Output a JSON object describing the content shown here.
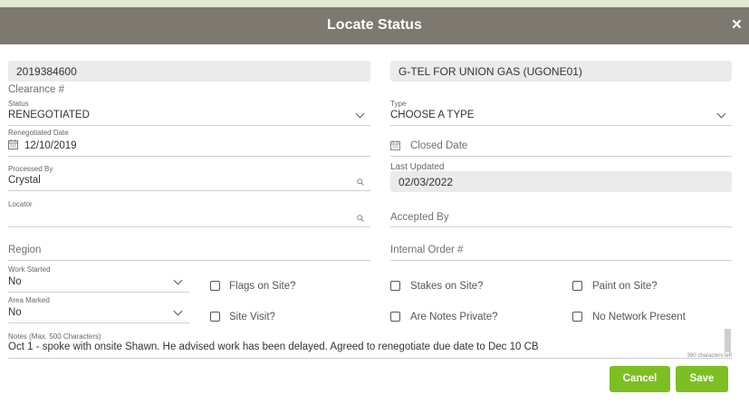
{
  "dialog": {
    "title": "Locate Status",
    "close_symbol": "×"
  },
  "fields": {
    "ticket_number": "2019384600",
    "company": "G-TEL FOR UNION GAS (UGONE01)",
    "clearance_placeholder": "Clearance #",
    "status_label": "Status",
    "status_value": "RENEGOTIATED",
    "type_label": "Type",
    "type_value": "CHOOSE A TYPE",
    "renegotiated_date_label": "Renegotiated Date",
    "renegotiated_date_value": "12/10/2019",
    "closed_date_placeholder": "Closed Date",
    "processed_by_label": "Processed By",
    "processed_by_value": "Crystal",
    "last_updated_label": "Last Updated",
    "last_updated_value": "02/03/2022",
    "locator_label": "Locator",
    "accepted_by_placeholder": "Accepted By",
    "region_placeholder": "Region",
    "internal_order_placeholder": "Internal Order #",
    "work_started_label": "Work Started",
    "work_started_value": "No",
    "area_marked_label": "Area Marked",
    "area_marked_value": "No"
  },
  "checkboxes": {
    "flags_on_site": "Flags on Site?",
    "stakes_on_site": "Stakes on Site?",
    "paint_on_site": "Paint on Site?",
    "site_visit": "Site Visit?",
    "notes_private": "Are Notes Private?",
    "no_network_present": "No Network Present"
  },
  "notes": {
    "label": "Notes (Max. 500 Characters)",
    "value": "Oct 1 - spoke with onsite Shawn. He advised work has been delayed. Agreed to renegotiate due date to Dec 10 CB",
    "chars_left": "390 characters left"
  },
  "buttons": {
    "cancel": "Cancel",
    "save": "Save"
  },
  "icons": {
    "close": "close-icon",
    "chevron": "chevron-down-icon",
    "search": "search-icon",
    "calendar": "calendar-icon"
  },
  "colors": {
    "header": "#7d7870",
    "button": "#7cbf22",
    "page_background": "#dfe9d3",
    "readonly_field": "#ebebeb"
  }
}
